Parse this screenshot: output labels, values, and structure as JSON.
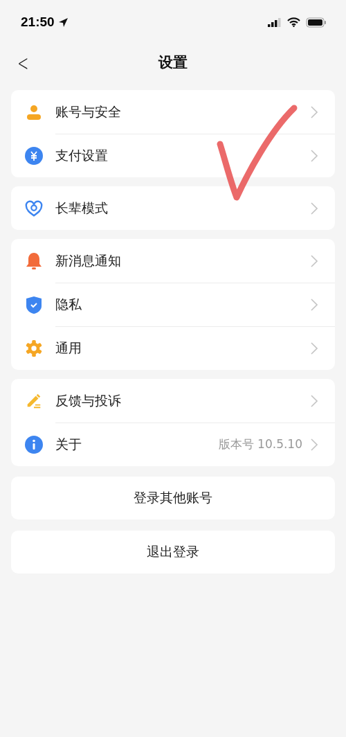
{
  "status_bar": {
    "time": "21:50"
  },
  "nav": {
    "back": "<",
    "title": "设置"
  },
  "groups": [
    {
      "rows": [
        {
          "label": "账号与安全"
        },
        {
          "label": "支付设置"
        }
      ]
    },
    {
      "rows": [
        {
          "label": "长辈模式"
        }
      ]
    },
    {
      "rows": [
        {
          "label": "新消息通知"
        },
        {
          "label": "隐私"
        },
        {
          "label": "通用"
        }
      ]
    },
    {
      "rows": [
        {
          "label": "反馈与投诉"
        },
        {
          "label": "关于",
          "value": "版本号 10.5.10"
        }
      ]
    }
  ],
  "buttons": [
    "登录其他账号",
    "退出登录"
  ]
}
